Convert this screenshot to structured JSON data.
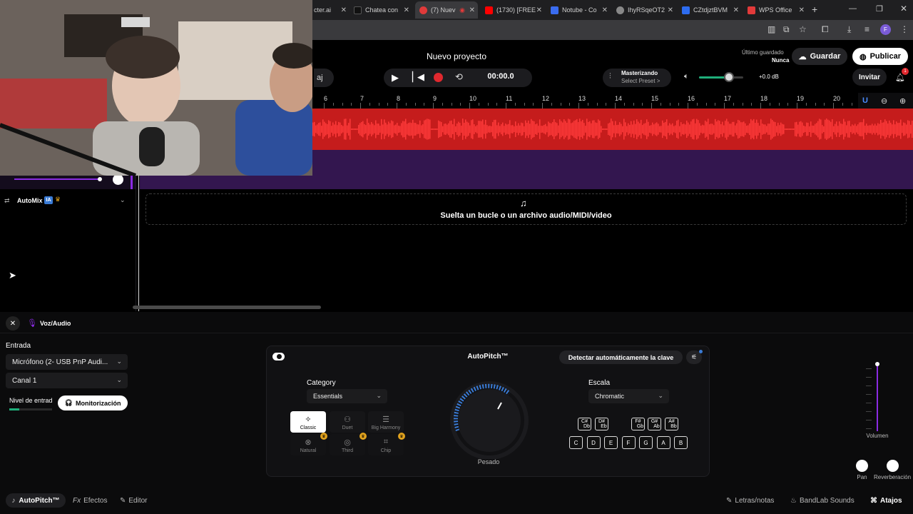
{
  "browser": {
    "tabs": [
      {
        "label": "cter.ai",
        "color": "#6b6bff"
      },
      {
        "label": "Chatea con",
        "color": "#111111"
      },
      {
        "label": "(7) Nuev",
        "color": "#e03a3a"
      },
      {
        "label": "(1730) [FREE",
        "color": "#ff0000"
      },
      {
        "label": "Notube - Co",
        "color": "#3a6cf0"
      },
      {
        "label": "IhyRSqeOT2",
        "color": "#888888"
      },
      {
        "label": "CZtdjztBVM",
        "color": "#2d6cf0"
      },
      {
        "label": "WPS Office",
        "color": "#e23a3a"
      }
    ],
    "new_tab": "+",
    "profile_initial": "F"
  },
  "header": {
    "project_title": "Nuevo proyecto",
    "last_saved_label": "Último guardado",
    "last_saved_value": "Nunca",
    "save_label": "Guardar",
    "publish_label": "Publicar",
    "time": "00:00.0",
    "mastering_label": "Masterizando",
    "mastering_preset": "Select Preset >",
    "volume_db": "+0.0 dB",
    "invite_label": "Invitar",
    "notif_count": "1",
    "left_chip": "aj"
  },
  "ruler": {
    "marks": [
      "6",
      "7",
      "8",
      "9",
      "10",
      "11",
      "12",
      "13",
      "14",
      "15",
      "16",
      "17",
      "18",
      "19",
      "20"
    ]
  },
  "left_panel": {
    "automix_label": "AutoMix",
    "ia_badge": "IA"
  },
  "drop_zone": {
    "text": "Suelta un bucle o un archivo audio/MIDI/video"
  },
  "voice_panel": {
    "title": "Voz/Audio",
    "input_label": "Entrada",
    "input_device": "Micrófono (2- USB PnP Audi...",
    "channel": "Canal 1",
    "input_level_label": "Nivel de entrad",
    "monitoring_label": "Monitorización"
  },
  "autopitch": {
    "title": "AutoPitch™",
    "detect_key_label": "Detectar automáticamente la clave",
    "category_label": "Category",
    "category_value": "Essentials",
    "modes": [
      "Classic",
      "Duet",
      "Big Harmony",
      "Natural",
      "Third",
      "Chip"
    ],
    "knob_label": "Pesado",
    "scale_label": "Escala",
    "scale_value": "Chromatic",
    "sharps": [
      [
        "C#",
        "Db"
      ],
      [
        "D#",
        "Eb"
      ],
      [
        "F#",
        "Gb"
      ],
      [
        "G#",
        "Ab"
      ],
      [
        "A#",
        "Bb"
      ]
    ],
    "naturals": [
      "C",
      "D",
      "E",
      "F",
      "G",
      "A",
      "B"
    ]
  },
  "right_controls": {
    "volume_label": "Volumen",
    "pan_label": "Pan",
    "reverb_label": "Reverberación"
  },
  "bottom_bar": {
    "autopitch_tab": "AutoPitch™",
    "effects_tab": "Efectos",
    "editor_tab": "Editor",
    "lyrics_label": "Letras/notas",
    "sounds_label": "BandLab Sounds",
    "shortcuts_label": "Atajos"
  },
  "colors": {
    "accent_purple": "#8a2be2",
    "record_red": "#e0282e",
    "waveform_red": "#c51c1c",
    "track_purple": "#33164f"
  }
}
